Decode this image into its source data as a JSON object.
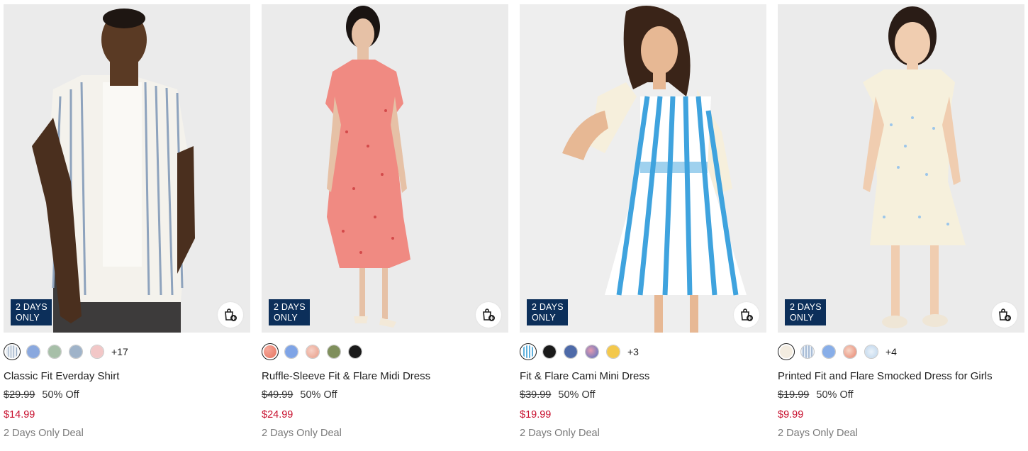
{
  "products": [
    {
      "name": "Classic Fit Everday Shirt",
      "badge_line1": "2 DAYS",
      "badge_line2": "ONLY",
      "original_price": "$29.99",
      "discount": "50% Off",
      "sale_price": "$14.99",
      "deal_text": "2 Days Only Deal",
      "more_colors": "+17",
      "swatches": [
        "#e9eef3",
        "#8aa8de",
        "#a7bfa8",
        "#9fb3c9",
        "#f2c7c7"
      ],
      "photo_bg": "#ebebeb"
    },
    {
      "name": "Ruffle-Sleeve Fit & Flare Midi Dress",
      "badge_line1": "2 DAYS",
      "badge_line2": "ONLY",
      "original_price": "$49.99",
      "discount": "50% Off",
      "sale_price": "$24.99",
      "deal_text": "2 Days Only Deal",
      "more_colors": "",
      "swatches": [
        "#ee8a78",
        "#7fa4e6",
        "#f0b9a8",
        "#7f8f5c",
        "#1a1a1a"
      ],
      "photo_bg": "#ebebeb"
    },
    {
      "name": "Fit & Flare Cami Mini Dress",
      "badge_line1": "2 DAYS",
      "badge_line2": "ONLY",
      "original_price": "$39.99",
      "discount": "50% Off",
      "sale_price": "$19.99",
      "deal_text": "2 Days Only Deal",
      "more_colors": "+3",
      "swatches": [
        "#8fc0dc",
        "#1a1a1a",
        "#4e6aa8",
        "#c06b8a",
        "#f3c84c"
      ],
      "photo_bg": "#eeeeee"
    },
    {
      "name": "Printed Fit and Flare Smocked Dress for Girls",
      "badge_line1": "2 DAYS",
      "badge_line2": "ONLY",
      "original_price": "$19.99",
      "discount": "50% Off",
      "sale_price": "$9.99",
      "deal_text": "2 Days Only Deal",
      "more_colors": "+4",
      "swatches": [
        "#f3ece0",
        "#b8c8dc",
        "#88aee8",
        "#f1b7a6",
        "#d6e6f2"
      ],
      "photo_bg": "#ebebeb"
    }
  ],
  "icons": {
    "bag": "add-to-bag-icon"
  },
  "colors": {
    "badge_bg": "#0c2f5a",
    "sale_red": "#c8102e",
    "muted": "#7a7a7a"
  }
}
